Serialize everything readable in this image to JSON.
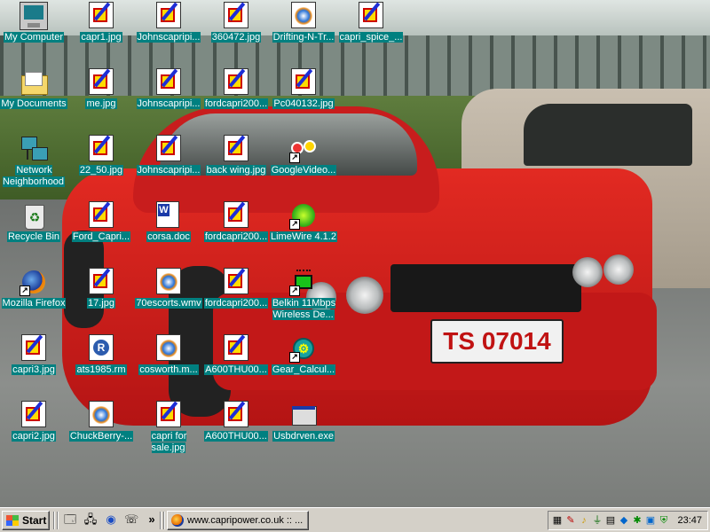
{
  "desktop": {
    "icons": [
      {
        "label": "My Computer",
        "icon": "computer-icon"
      },
      {
        "label": "My Documents",
        "icon": "folder-icon"
      },
      {
        "label": "Network Neighborhood",
        "icon": "network-icon"
      },
      {
        "label": "Recycle Bin",
        "icon": "recycle-bin-icon"
      },
      {
        "label": "Mozilla Firefox",
        "icon": "firefox-icon"
      },
      {
        "label": "capri3.jpg",
        "icon": "image-file-icon"
      },
      {
        "label": "capri2.jpg",
        "icon": "image-file-icon"
      },
      {
        "label": "capr1.jpg",
        "icon": "image-file-icon"
      },
      {
        "label": "me.jpg",
        "icon": "image-file-icon"
      },
      {
        "label": "22_50.jpg",
        "icon": "image-file-icon"
      },
      {
        "label": "Ford_Capri...",
        "icon": "image-file-icon"
      },
      {
        "label": "17.jpg",
        "icon": "image-file-icon"
      },
      {
        "label": "ats1985.rm",
        "icon": "realmedia-file-icon"
      },
      {
        "label": "ChuckBerry-...",
        "icon": "media-file-icon"
      },
      {
        "label": "Johnscapripi...",
        "icon": "image-file-icon"
      },
      {
        "label": "Johnscapripi...",
        "icon": "image-file-icon"
      },
      {
        "label": "Johnscapripi...",
        "icon": "image-file-icon"
      },
      {
        "label": "corsa.doc",
        "icon": "word-document-icon"
      },
      {
        "label": "70escorts.wmv",
        "icon": "media-file-icon"
      },
      {
        "label": "cosworth.m...",
        "icon": "media-file-icon"
      },
      {
        "label": "capri for sale.jpg",
        "icon": "image-file-icon"
      },
      {
        "label": "360472.jpg",
        "icon": "image-file-icon"
      },
      {
        "label": "fordcapri200...",
        "icon": "image-file-icon"
      },
      {
        "label": "back wing.jpg",
        "icon": "image-file-icon"
      },
      {
        "label": "fordcapri200...",
        "icon": "image-file-icon"
      },
      {
        "label": "fordcapri200...",
        "icon": "image-file-icon"
      },
      {
        "label": "A600THU00...",
        "icon": "image-file-icon"
      },
      {
        "label": "A600THU00...",
        "icon": "image-file-icon"
      },
      {
        "label": "Drifting-N-Tr...",
        "icon": "media-file-icon"
      },
      {
        "label": "Pc040132.jpg",
        "icon": "image-file-icon"
      },
      {
        "label": "GoogleVideo...",
        "icon": "google-video-icon"
      },
      {
        "label": "LimeWire 4.1.2",
        "icon": "limewire-icon"
      },
      {
        "label": "Belkin 11Mbps Wireless De...",
        "icon": "belkin-wireless-icon"
      },
      {
        "label": "Gear_Calcul...",
        "icon": "gear-calculator-icon"
      },
      {
        "label": "Usbdrven.exe",
        "icon": "executable-icon"
      },
      {
        "label": "capri_spice_...",
        "icon": "image-file-icon"
      }
    ],
    "wallpaper": {
      "plate_text": "TS 07014"
    }
  },
  "taskbar": {
    "start_label": "Start",
    "quick_launch_overflow": "»",
    "tasks": [
      {
        "label": "www.capripower.co.uk :: ...",
        "icon": "firefox-icon"
      }
    ],
    "clock": "23:47"
  },
  "colors": {
    "taskbar": "#d4d0c8",
    "label_background": "#008080",
    "car": "#d61f1f"
  }
}
